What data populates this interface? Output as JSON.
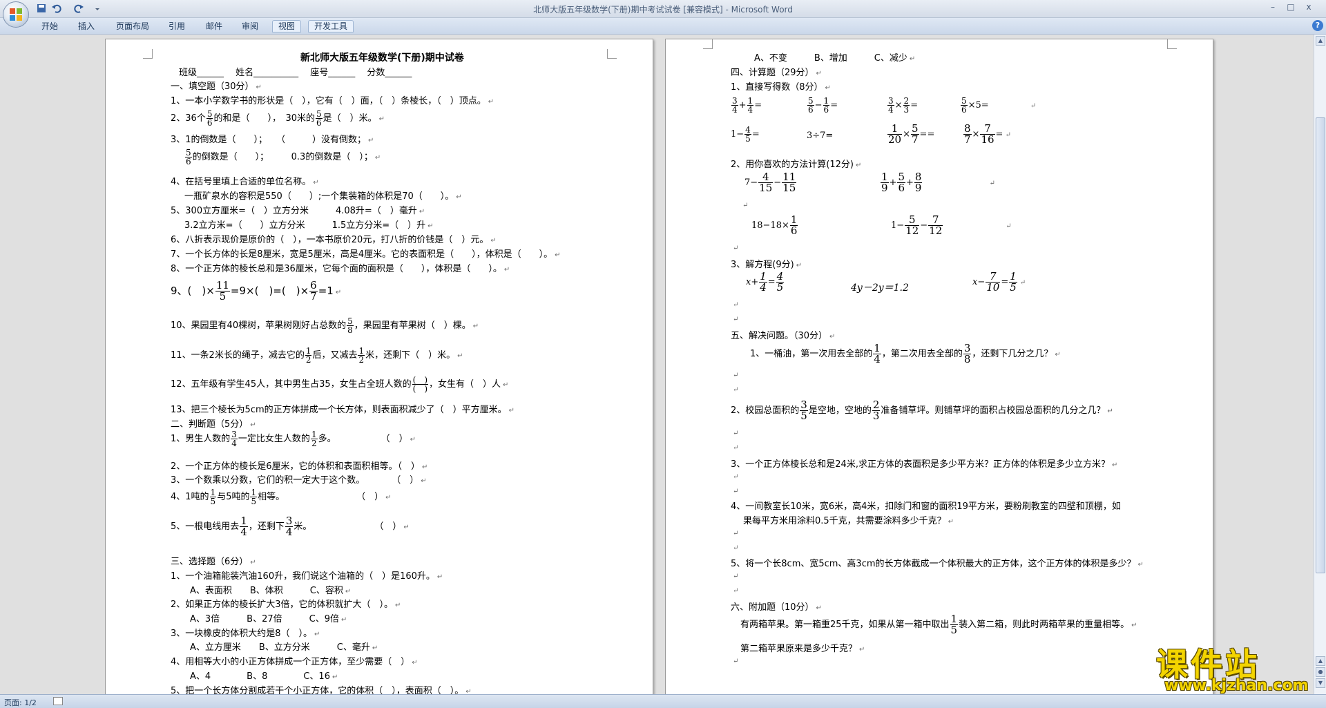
{
  "window": {
    "title": "北师大版五年级数学(下册)期中考试试卷 [兼容模式] - Microsoft Word",
    "minimize": "–",
    "maximize": "□",
    "close": "x"
  },
  "ribbon": {
    "tabs": [
      "开始",
      "插入",
      "页面布局",
      "引用",
      "邮件",
      "审阅",
      "视图",
      "开发工具"
    ],
    "help": "?"
  },
  "status": {
    "page": "页面: 1/2"
  },
  "watermark": {
    "main": "课件站",
    "url": "www.kjzhan.com"
  },
  "page1": {
    "title": "新北师大版五年级数学(下册)期中试卷",
    "header": "班级______ 　姓名__________ 　座号______ 　分数______",
    "s1": "一、填空题（30分）",
    "q1": "1、一本小学数学书的形状是（　），它有（　）面，（　）条棱长，（　）顶点。",
    "q2a": "2、36个",
    "q2b": "的和是（　　），　30米的",
    "q2c": "是（　）米。",
    "q3a": "3、1的倒数是（　　）；　　（　　　）没有倒数；",
    "q3b": "的倒数是（　　）；　　　0.3的倒数是（　）；",
    "q4": "4、在括号里填上合适的单位名称。",
    "q4b": "一瓶矿泉水的容积是550（　　）;一个集装箱的体积是70（　　）。",
    "q5a": "5、300立方厘米=（　）立方分米　　　4.08升=（　）毫升",
    "q5b": "3.2立方米=（　　）立方分米　　　1.5立方分米=（　）升",
    "q6": "6、八折表示现价是原价的（　），一本书原价20元，打八折的价钱是（　）元。",
    "q7": "7、一个长方体的长是8厘米，宽是5厘米，高是4厘米。它的表面积是（　　），体积是（　　）。",
    "q8": "8、一个正方体的棱长总和是36厘米，它每个面的面积是（　　），体积是（　　）。",
    "q9a": "9、(　)×",
    "q9b": "=9×(　)=(　)×",
    "q9c": "=1",
    "q10a": "10、果园里有40棵树，苹果树刚好占总数的",
    "q10b": "，果园里有苹果树（　）棵。",
    "q11a": "11、一条2米长的绳子，减去它的",
    "q11b": "后，又减去",
    "q11c": "米，还剩下（　）米。",
    "q12a": "12、五年级有学生45人，其中男生占35，女生占全班人数的",
    "q12b": "，女生有（　）人",
    "q13": "13、把三个棱长为5cm的正方体拼成一个长方体，则表面积减少了（　）平方厘米。",
    "s2": "二、判断题（5分）",
    "j1a": "1、男生人数的",
    "j1b": "一定比女生人数的",
    "j1c": "多。　　　　　　（　）",
    "j2": "2、一个正方体的棱长是6厘米，它的体积和表面积相等。（　）",
    "j3": "3、一个数乘以分数，它们的积一定大于这个数。　　　　（　）",
    "j4a": "4、1吨的",
    "j4b": "与5吨的",
    "j4c": "相等。　　　　　　　　　（　）",
    "j5a": "5、一根电线用去",
    "j5b": "，还剩下",
    "j5c": "米。　　　　　　　　（　）",
    "s3": "三、选择题（6分）",
    "c1": "1、一个油箱能装汽油160升，我们说这个油箱的（　）是160升。",
    "c1o": "A、表面积　　B、体积　　　C、容积",
    "c2": "2、如果正方体的棱长扩大3倍，它的体积就扩大（　）。",
    "c2o": "A、3倍　　　B、27倍　　　C、9倍",
    "c3": "3、一块橡皮的体积大约是8（　）。",
    "c3o": "A、立方厘米　　B、立方分米　　　C、毫升",
    "c4": "4、用相等大小的小正方体拼成一个正方体，至少需要（　）",
    "c4o": "A、4　　　　B、8　　　　C、16",
    "c5": "5、把一个长方体分割成若干个小正方体，它的体积（　），表面积（　）。"
  },
  "page2": {
    "opts": "A、不变　　　B、增加　　　C、减少",
    "s4": "四、计算题（29分）",
    "c4_1": "1、直接写得数（8分）",
    "c4_2": "2、用你喜欢的方法计算(12分)",
    "c4_3": "3、解方程(9分)",
    "eq2": "4y－2y＝1.2",
    "s5": "五、解决问题。（30分）",
    "p1a": "1、一桶油，第一次用去全部的",
    "p1b": "，第二次用去全部的",
    "p1c": "，还剩下几分之几？",
    "p2a": "2、校园总面积的",
    "p2b": "是空地，空地的",
    "p2c": "准备铺草坪。则铺草坪的面积占校园总面积的几分之几？",
    "p3": "3、一个正方体棱长总和是24米,求正方体的表面积是多少平方米？正方体的体积是多少立方米？",
    "p4a": "4、一间教室长10米，宽6米，高4米，扣除门和窗的面积19平方米，要粉刷教室的四壁和顶棚，如",
    "p4b": "果每平方米用涂料0.5千克，共需要涂料多少千克？",
    "p5": "5、将一个长8cm、宽5cm、高3cm的长方体截成一个体积最大的正方体，这个正方体的体积是多少？",
    "s6": "六、附加题（10分）",
    "x1a": "有两箱苹果。第一箱重25千克，如果从第一箱中取出",
    "x1b": "装入第二箱，则此时两箱苹果的重量相等。",
    "x2": "第二箱苹果原来是多少千克？"
  }
}
